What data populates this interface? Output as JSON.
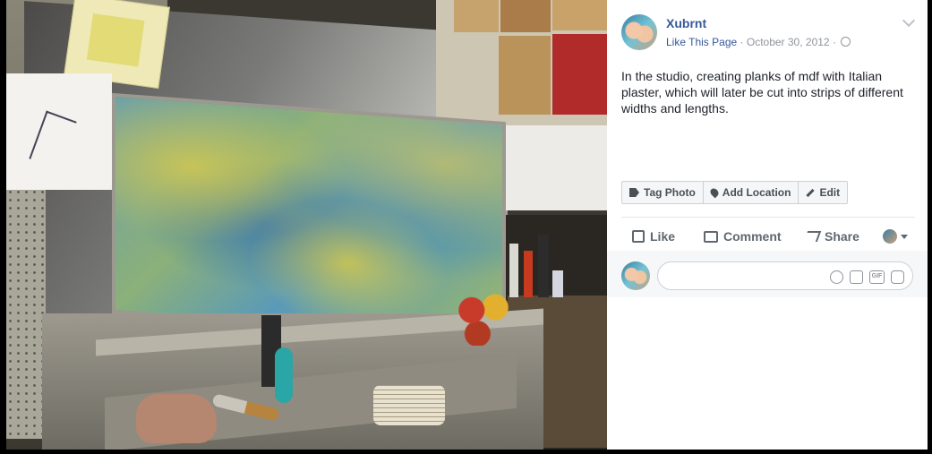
{
  "post": {
    "author": "Xubrnt",
    "like_page": "Like This Page",
    "separator": "·",
    "date": "October 30, 2012",
    "caption": "In the studio, creating planks of mdf with Italian plaster, which will later be cut into strips of different widths and lengths."
  },
  "photo_tools": {
    "tag": "Tag Photo",
    "location": "Add Location",
    "edit": "Edit"
  },
  "actions": {
    "like": "Like",
    "comment": "Comment",
    "share": "Share"
  },
  "comment_box": {
    "placeholder": ""
  },
  "icons": {
    "chevron": "chevron-down-icon",
    "globe": "globe-icon",
    "emoji": "emoji-icon",
    "camera": "camera-icon",
    "gif": "gif-icon",
    "sticker": "sticker-icon"
  },
  "colors": {
    "link": "#365899",
    "meta": "#90949c",
    "action": "#606770",
    "background": "#000000"
  }
}
